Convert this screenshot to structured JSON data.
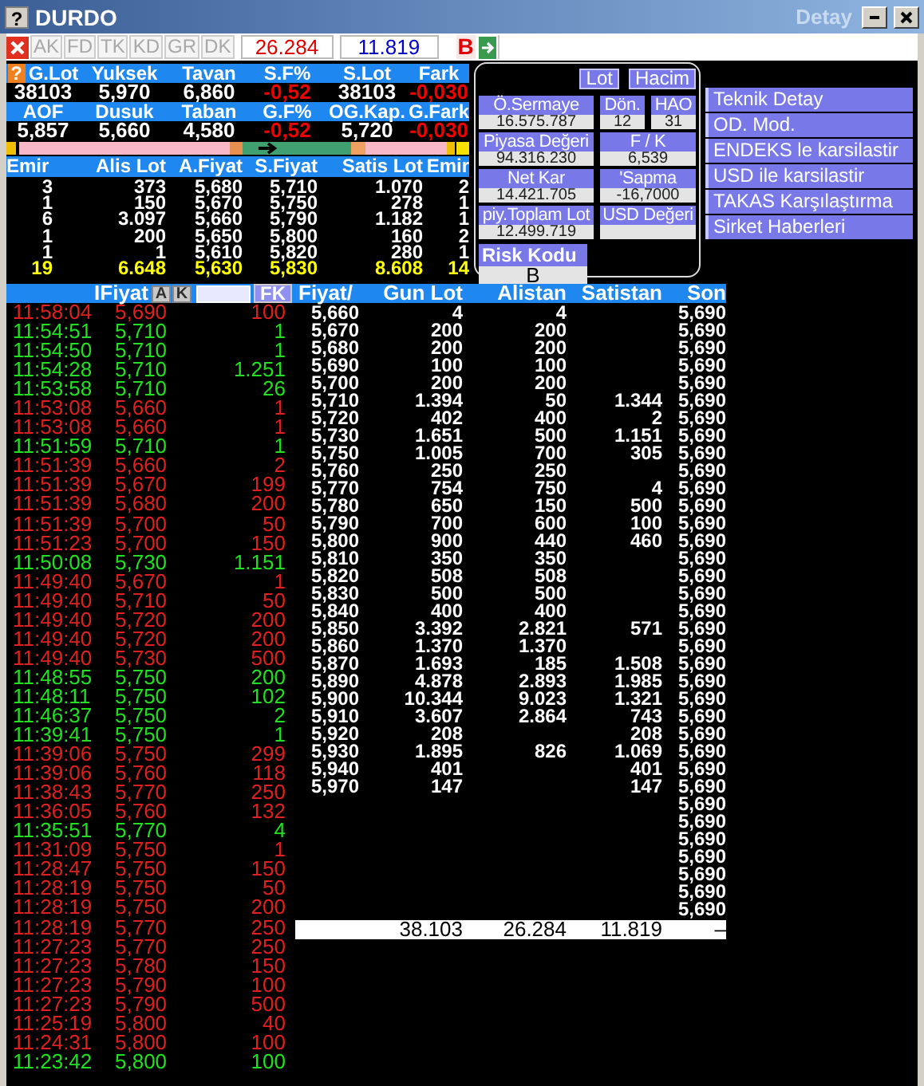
{
  "window": {
    "icon": "?",
    "title": "DURDO",
    "subtitle": "Detay"
  },
  "toolbar": {
    "buttons": [
      {
        "label": "AK",
        "disabled": true
      },
      {
        "label": "FD",
        "disabled": true
      },
      {
        "label": "TK",
        "disabled": true
      },
      {
        "label": "KD",
        "disabled": true
      },
      {
        "label": "GR",
        "disabled": true
      },
      {
        "label": "DK",
        "disabled": true
      }
    ],
    "bid_total": "26.284",
    "ask_total": "11.819",
    "flag": "B"
  },
  "stats": {
    "help": "?",
    "rows": [
      {
        "headers": [
          "G.Lot",
          "Yuksek",
          "Tavan",
          "S.F%",
          "S.Lot",
          "Fark"
        ],
        "values": [
          {
            "text": "38103",
            "negative": false
          },
          {
            "text": "5,970",
            "negative": false
          },
          {
            "text": "6,860",
            "negative": false
          },
          {
            "text": "-0,52",
            "negative": true
          },
          {
            "text": "38103",
            "negative": false
          },
          {
            "text": "-0,030",
            "negative": true
          }
        ]
      },
      {
        "headers": [
          "AOF",
          "Dusuk",
          "Taban",
          "G.F%",
          "OG.Kap.",
          "G.Fark"
        ],
        "values": [
          {
            "text": "5,857",
            "negative": false
          },
          {
            "text": "5,660",
            "negative": false
          },
          {
            "text": "4,580",
            "negative": false
          },
          {
            "text": "-0,52",
            "negative": true
          },
          {
            "text": "5,720",
            "negative": false
          },
          {
            "text": "-0,030",
            "negative": true
          }
        ]
      }
    ]
  },
  "order_book": {
    "columns": [
      "Emir",
      "Alis Lot",
      "A.Fiyat",
      "S.Fiyat",
      "Satis Lot",
      "Emir"
    ],
    "rows": [
      [
        "3",
        "373",
        "5,680",
        "5,710",
        "1.070",
        "2"
      ],
      [
        "1",
        "150",
        "5,670",
        "5,750",
        "278",
        "1"
      ],
      [
        "6",
        "3.097",
        "5,660",
        "5,790",
        "1.182",
        "1"
      ],
      [
        "1",
        "200",
        "5,650",
        "5,800",
        "160",
        "2"
      ],
      [
        "1",
        "1",
        "5,610",
        "5,820",
        "280",
        "1"
      ]
    ],
    "total": [
      "19",
      "6.648",
      "5,630",
      "5,830",
      "8.608",
      "14"
    ]
  },
  "fundamentals": {
    "toggles": [
      "Lot",
      "Hacim"
    ],
    "rows": [
      [
        {
          "label": "Ö.Sermaye",
          "value": "16.575.787"
        },
        {
          "label": "Dön.",
          "value": "12"
        },
        {
          "label": "HAO",
          "value": "31"
        }
      ],
      [
        {
          "label": "Piyasa Değeri",
          "value": "94.316.230"
        },
        {
          "label": "F / K",
          "value": "6,539"
        }
      ],
      [
        {
          "label": "Net Kar",
          "value": "14.421.705"
        },
        {
          "label": "'Sapma",
          "value": "-16,7000"
        }
      ],
      [
        {
          "label": "piy.Toplam Lot",
          "value": "12.499.719"
        },
        {
          "label": "USD Değeri"
        }
      ]
    ],
    "risk": {
      "label": "Risk Kodu",
      "value": "B"
    }
  },
  "links": [
    "Teknik Detay",
    "OD. Mod.",
    "ENDEKS le karsilastir",
    "USD ile karsilastir",
    "TAKAS Karşılaştırma",
    "Sirket Haberleri"
  ],
  "trades": {
    "price_label": "IFiyat",
    "buttons": [
      "A",
      "K"
    ],
    "filter_button": "FK",
    "rows": [
      {
        "time": "11:58:04",
        "price": "5,690",
        "lot": "100",
        "color": "#e02020"
      },
      {
        "time": "11:54:51",
        "price": "5,710",
        "lot": "1",
        "color": "#20e020"
      },
      {
        "time": "11:54:50",
        "price": "5,710",
        "lot": "1",
        "color": "#20e020"
      },
      {
        "time": "11:54:28",
        "price": "5,710",
        "lot": "1.251",
        "color": "#20e020"
      },
      {
        "time": "11:53:58",
        "price": "5,710",
        "lot": "26",
        "color": "#20e020"
      },
      {
        "time": "11:53:08",
        "price": "5,660",
        "lot": "1",
        "color": "#e02020"
      },
      {
        "time": "11:53:08",
        "price": "5,660",
        "lot": "1",
        "color": "#e02020"
      },
      {
        "time": "11:51:59",
        "price": "5,710",
        "lot": "1",
        "color": "#20e020"
      },
      {
        "time": "11:51:39",
        "price": "5,660",
        "lot": "2",
        "color": "#e02020"
      },
      {
        "time": "11:51:39",
        "price": "5,670",
        "lot": "199",
        "color": "#e02020"
      },
      {
        "time": "11:51:39",
        "price": "5,680",
        "lot": "200",
        "color": "#e02020"
      },
      {
        "time": "11:51:39",
        "price": "5,700",
        "lot": "50",
        "color": "#e02020"
      },
      {
        "time": "11:51:23",
        "price": "5,700",
        "lot": "150",
        "color": "#e02020"
      },
      {
        "time": "11:50:08",
        "price": "5,730",
        "lot": "1.151",
        "color": "#20e020"
      },
      {
        "time": "11:49:40",
        "price": "5,670",
        "lot": "1",
        "color": "#e02020"
      },
      {
        "time": "11:49:40",
        "price": "5,710",
        "lot": "50",
        "color": "#e02020"
      },
      {
        "time": "11:49:40",
        "price": "5,720",
        "lot": "200",
        "color": "#e02020"
      },
      {
        "time": "11:49:40",
        "price": "5,720",
        "lot": "200",
        "color": "#e02020"
      },
      {
        "time": "11:49:40",
        "price": "5,730",
        "lot": "500",
        "color": "#e02020"
      },
      {
        "time": "11:48:55",
        "price": "5,750",
        "lot": "200",
        "color": "#20e020"
      },
      {
        "time": "11:48:11",
        "price": "5,750",
        "lot": "102",
        "color": "#20e020"
      },
      {
        "time": "11:46:37",
        "price": "5,750",
        "lot": "2",
        "color": "#20e020"
      },
      {
        "time": "11:39:41",
        "price": "5,750",
        "lot": "1",
        "color": "#20e020"
      },
      {
        "time": "11:39:06",
        "price": "5,750",
        "lot": "299",
        "color": "#e02020"
      },
      {
        "time": "11:39:06",
        "price": "5,760",
        "lot": "118",
        "color": "#e02020"
      },
      {
        "time": "11:38:43",
        "price": "5,770",
        "lot": "250",
        "color": "#e02020"
      },
      {
        "time": "11:36:05",
        "price": "5,760",
        "lot": "132",
        "color": "#e02020"
      },
      {
        "time": "11:35:51",
        "price": "5,770",
        "lot": "4",
        "color": "#20e020"
      },
      {
        "time": "11:31:09",
        "price": "5,750",
        "lot": "1",
        "color": "#e02020"
      },
      {
        "time": "11:28:47",
        "price": "5,750",
        "lot": "150",
        "color": "#e02020"
      },
      {
        "time": "11:28:19",
        "price": "5,750",
        "lot": "50",
        "color": "#e02020"
      },
      {
        "time": "11:28:19",
        "price": "5,750",
        "lot": "200",
        "color": "#e02020"
      },
      {
        "time": "11:28:19",
        "price": "5,770",
        "lot": "250",
        "color": "#e02020"
      },
      {
        "time": "11:27:23",
        "price": "5,770",
        "lot": "250",
        "color": "#e02020"
      },
      {
        "time": "11:27:23",
        "price": "5,780",
        "lot": "150",
        "color": "#e02020"
      },
      {
        "time": "11:27:23",
        "price": "5,790",
        "lot": "100",
        "color": "#e02020"
      },
      {
        "time": "11:27:23",
        "price": "5,790",
        "lot": "500",
        "color": "#e02020"
      },
      {
        "time": "11:25:19",
        "price": "5,800",
        "lot": "40",
        "color": "#e02020"
      },
      {
        "time": "11:24:31",
        "price": "5,800",
        "lot": "100",
        "color": "#e02020"
      },
      {
        "time": "11:23:42",
        "price": "5,800",
        "lot": "100",
        "color": "#20e020"
      }
    ]
  },
  "price_table": {
    "columns": [
      "Fiyat/",
      "Gun Lot",
      "Alistan",
      "Satistan",
      "Son"
    ],
    "rows": [
      {
        "fiyat": "5,660",
        "gun_lot": "4",
        "alistan": "4",
        "son": "5,690"
      },
      {
        "fiyat": "5,670",
        "gun_lot": "200",
        "alistan": "200",
        "son": "5,690"
      },
      {
        "fiyat": "5,680",
        "gun_lot": "200",
        "alistan": "200",
        "son": "5,690"
      },
      {
        "fiyat": "5,690",
        "gun_lot": "100",
        "alistan": "100",
        "son": "5,690"
      },
      {
        "fiyat": "5,700",
        "gun_lot": "200",
        "alistan": "200",
        "son": "5,690"
      },
      {
        "fiyat": "5,710",
        "gun_lot": "1.394",
        "alistan": "50",
        "satistan": "1.344",
        "son": "5,690"
      },
      {
        "fiyat": "5,720",
        "gun_lot": "402",
        "alistan": "400",
        "satistan": "2",
        "son": "5,690"
      },
      {
        "fiyat": "5,730",
        "gun_lot": "1.651",
        "alistan": "500",
        "satistan": "1.151",
        "son": "5,690"
      },
      {
        "fiyat": "5,750",
        "gun_lot": "1.005",
        "alistan": "700",
        "satistan": "305",
        "son": "5,690"
      },
      {
        "fiyat": "5,760",
        "gun_lot": "250",
        "alistan": "250",
        "son": "5,690"
      },
      {
        "fiyat": "5,770",
        "gun_lot": "754",
        "alistan": "750",
        "satistan": "4",
        "son": "5,690"
      },
      {
        "fiyat": "5,780",
        "gun_lot": "650",
        "alistan": "150",
        "satistan": "500",
        "son": "5,690"
      },
      {
        "fiyat": "5,790",
        "gun_lot": "700",
        "alistan": "600",
        "satistan": "100",
        "son": "5,690"
      },
      {
        "fiyat": "5,800",
        "gun_lot": "900",
        "alistan": "440",
        "satistan": "460",
        "son": "5,690"
      },
      {
        "fiyat": "5,810",
        "gun_lot": "350",
        "alistan": "350",
        "son": "5,690"
      },
      {
        "fiyat": "5,820",
        "gun_lot": "508",
        "alistan": "508",
        "son": "5,690"
      },
      {
        "fiyat": "5,830",
        "gun_lot": "500",
        "alistan": "500",
        "son": "5,690"
      },
      {
        "fiyat": "5,840",
        "gun_lot": "400",
        "alistan": "400",
        "son": "5,690"
      },
      {
        "fiyat": "5,850",
        "gun_lot": "3.392",
        "alistan": "2.821",
        "satistan": "571",
        "son": "5,690"
      },
      {
        "fiyat": "5,860",
        "gun_lot": "1.370",
        "alistan": "1.370",
        "son": "5,690"
      },
      {
        "fiyat": "5,870",
        "gun_lot": "1.693",
        "alistan": "185",
        "satistan": "1.508",
        "son": "5,690"
      },
      {
        "fiyat": "5,890",
        "gun_lot": "4.878",
        "alistan": "2.893",
        "satistan": "1.985",
        "son": "5,690"
      },
      {
        "fiyat": "5,900",
        "gun_lot": "10.344",
        "alistan": "9.023",
        "satistan": "1.321",
        "son": "5,690"
      },
      {
        "fiyat": "5,910",
        "gun_lot": "3.607",
        "alistan": "2.864",
        "satistan": "743",
        "son": "5,690"
      },
      {
        "fiyat": "5,920",
        "gun_lot": "208",
        "satistan": "208",
        "son": "5,690"
      },
      {
        "fiyat": "5,930",
        "gun_lot": "1.895",
        "alistan": "826",
        "satistan": "1.069",
        "son": "5,690"
      },
      {
        "fiyat": "5,940",
        "gun_lot": "401",
        "satistan": "401",
        "son": "5,690"
      },
      {
        "fiyat": "5,970",
        "gun_lot": "147",
        "satistan": "147",
        "son": "5,690"
      },
      {
        "son": "5,690"
      },
      {
        "son": "5,690"
      },
      {
        "son": "5,690"
      },
      {
        "son": "5,690"
      },
      {
        "son": "5,690"
      },
      {
        "son": "5,690"
      },
      {
        "son": "5,690"
      }
    ],
    "totals": {
      "gun_lot": "38.103",
      "alistan": "26.284",
      "satistan": "11.819",
      "son": "–"
    }
  }
}
